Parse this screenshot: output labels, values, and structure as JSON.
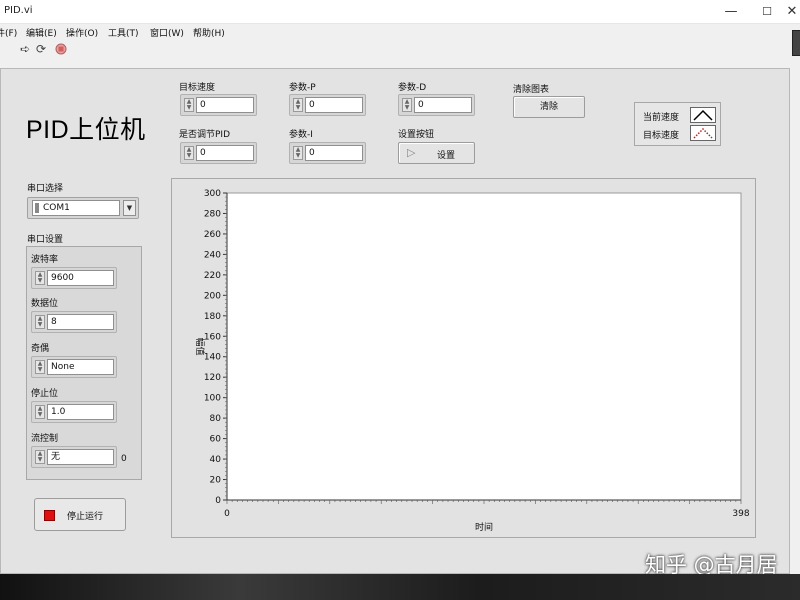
{
  "window": {
    "title": "PID.vi",
    "minimize": "—",
    "maximize": "☐",
    "close": "✕"
  },
  "menu": [
    "件(F)",
    "编辑(E)",
    "操作(O)",
    "工具(T)",
    "窗口(W)",
    "帮助(H)"
  ],
  "toolbar": {
    "icons": [
      "run-arrow-icon",
      "continuous-run-icon",
      "abort-icon"
    ]
  },
  "panel": {
    "title": "PID上位机",
    "target_speed": {
      "label": "目标速度",
      "value": "0"
    },
    "param_p": {
      "label": "参数-P",
      "value": "0"
    },
    "param_d": {
      "label": "参数-D",
      "value": "0"
    },
    "clear_chart": {
      "label": "清除图表",
      "button": "清除"
    },
    "adjust": {
      "label": "是否调节PID",
      "value": "0"
    },
    "param_i": {
      "label": "参数-I",
      "value": "0"
    },
    "set_button": {
      "label": "设置按钮",
      "button": "设置"
    },
    "legend": [
      {
        "name": "当前速度",
        "color": "#000000",
        "icon": "solid-line-icon"
      },
      {
        "name": "目标速度",
        "color": "#c02020",
        "icon": "dotted-line-icon"
      }
    ],
    "serial_select": {
      "label": "串口选择",
      "value": "COM1"
    },
    "serial_settings": {
      "label": "串口设置",
      "baud": {
        "label": "波特率",
        "value": "9600"
      },
      "data_bits": {
        "label": "数据位",
        "value": "8"
      },
      "parity": {
        "label": "奇偶",
        "value": "None"
      },
      "stop_bits": {
        "label": "停止位",
        "value": "1.0"
      },
      "flow": {
        "label": "流控制",
        "value": "无",
        "extra": "0"
      }
    },
    "stop_button": "停止运行"
  },
  "chart_data": {
    "type": "line",
    "title": "",
    "xlabel": "时间",
    "ylabel": "幅值",
    "xlim": [
      0,
      398
    ],
    "ylim": [
      0,
      300
    ],
    "x_ticks": [
      "0",
      "398"
    ],
    "y_ticks": [
      "0",
      "20",
      "40",
      "60",
      "80",
      "100",
      "120",
      "140",
      "160",
      "180",
      "200",
      "220",
      "240",
      "260",
      "280",
      "300"
    ],
    "series": [
      {
        "name": "当前速度",
        "values": []
      },
      {
        "name": "目标速度",
        "values": []
      }
    ],
    "grid": false,
    "legend": "top-right"
  },
  "watermark": "知乎 @古月居"
}
